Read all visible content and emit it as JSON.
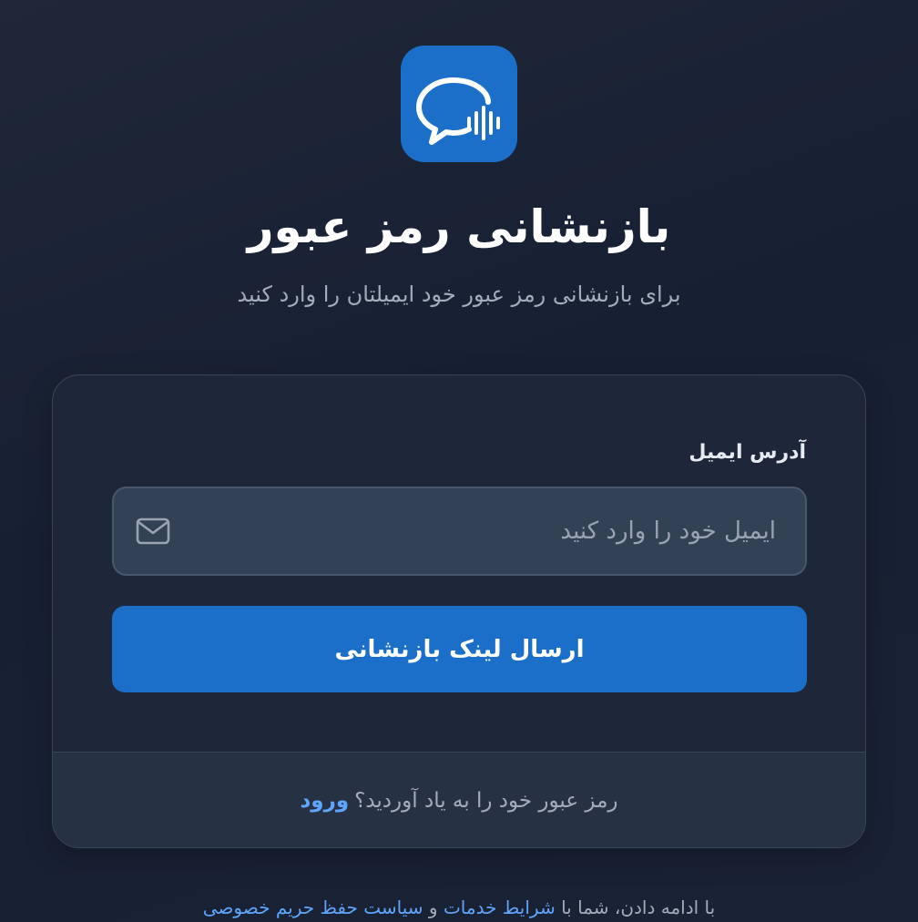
{
  "header": {
    "title": "بازنشانی رمز عبور",
    "subtitle": "برای بازنشانی رمز عبور خود ایمیلتان را وارد کنید",
    "logo_icon": "chat-bubble-voice-icon"
  },
  "form": {
    "email_label": "آدرس ایمیل",
    "email_placeholder": "ایمیل خود را وارد کنید",
    "email_value": "",
    "email_icon": "mail-icon",
    "submit_label": "ارسال لینک بازنشانی"
  },
  "footer": {
    "remember_text": "رمز عبور خود را به یاد آوردید؟",
    "login_link": "ورود"
  },
  "legal": {
    "prefix": "با ادامه دادن، شما با",
    "terms_link": "شرایط خدمات",
    "conjunction": "و",
    "privacy_link": "سیاست حفظ حریم خصوصی"
  },
  "colors": {
    "accent": "#1c6fc9",
    "link": "#60a5fa",
    "background": "#172033",
    "card": "#1e273a"
  }
}
